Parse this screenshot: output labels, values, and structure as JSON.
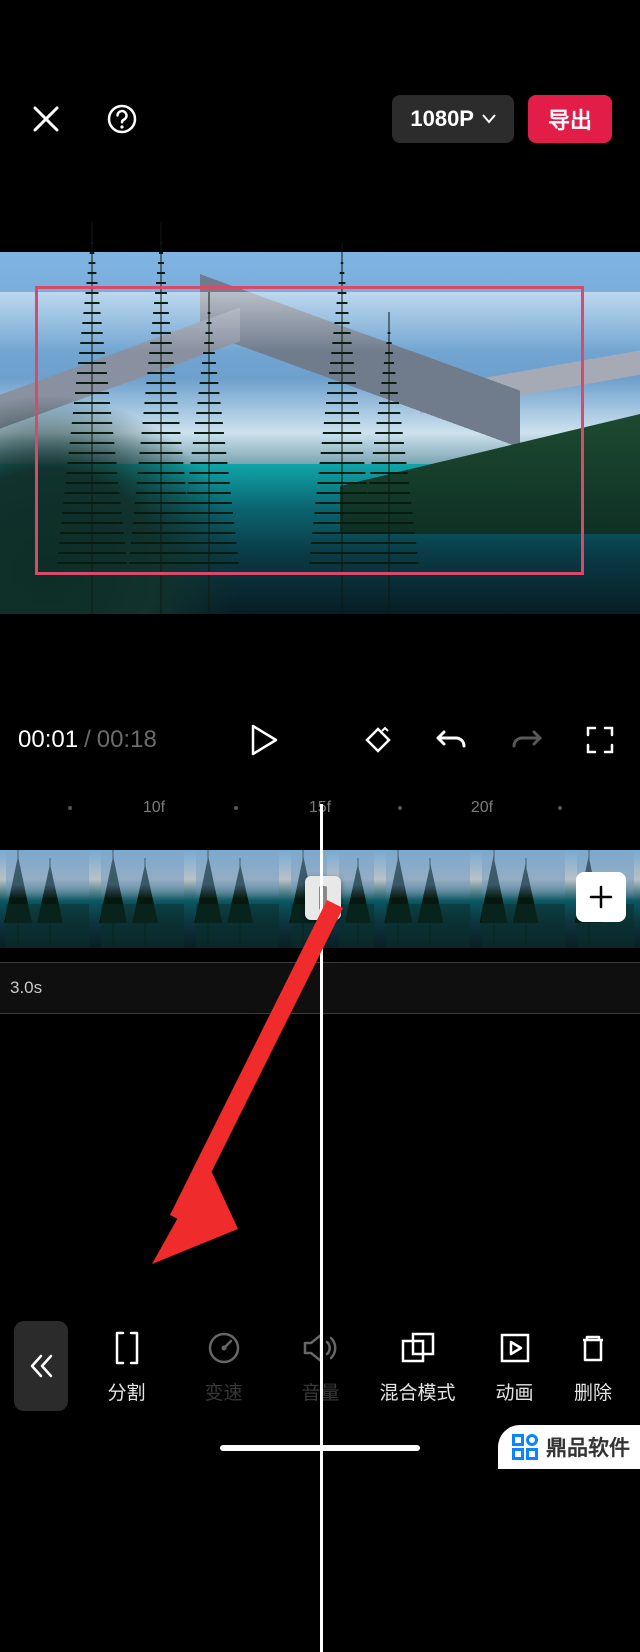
{
  "header": {
    "resolution": "1080P",
    "export_label": "导出"
  },
  "playbar": {
    "current_time": "00:01",
    "separator": "/",
    "total_time": "00:18"
  },
  "ruler": {
    "ticks": [
      {
        "label": "10f",
        "pos": 154
      },
      {
        "label": "15f",
        "pos": 320
      },
      {
        "label": "20f",
        "pos": 482
      }
    ],
    "dots": [
      70,
      236,
      400,
      560
    ]
  },
  "timeline": {
    "second_track_label": "3.0s"
  },
  "tools": {
    "split": "分割",
    "speed": "变速",
    "volume": "音量",
    "blend": "混合模式",
    "animation": "动画",
    "delete": "删除"
  },
  "watermark": "鼎品软件"
}
